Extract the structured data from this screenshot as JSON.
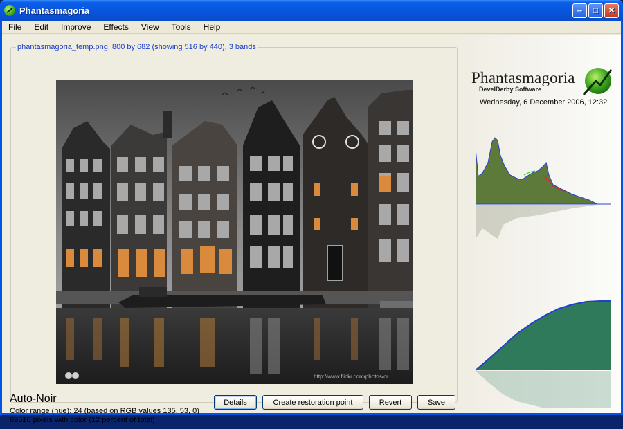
{
  "window": {
    "title": "Phantasmagoria",
    "minimize_glyph": "‒",
    "maximize_glyph": "□",
    "close_glyph": "✕"
  },
  "menu": [
    "File",
    "Edit",
    "Improve",
    "Effects",
    "View",
    "Tools",
    "Help"
  ],
  "image_panel": {
    "caption": "phantasmagoria_temp.png, 800 by 682 (showing 516 by 440), 3 bands",
    "watermark": "http://www.flickr.com/photos/cr..."
  },
  "effect": {
    "name": "Auto-Noir",
    "color_range": "Color range (hue): 24 (based on RGB values 135, 53, 0)",
    "pixels": "69516 pixels with color (12 percent of total)"
  },
  "buttons": {
    "details": "Details",
    "restore": "Create restoration point",
    "revert": "Revert",
    "save": "Save"
  },
  "side": {
    "logo_title": "Phantasmagoria",
    "logo_subtitle": "DevelDerby Software",
    "datetime": "Wednesday, 6 December 2006, 12:32"
  },
  "colors": {
    "title_bar": "#0756dd",
    "caption_text": "#1a3fc8",
    "histogram_fill": "#5e7a3a",
    "curve_fill": "#2f7a5a",
    "curve_line": "#1f3fd0"
  },
  "icons": {
    "app": "leaf-icon"
  }
}
